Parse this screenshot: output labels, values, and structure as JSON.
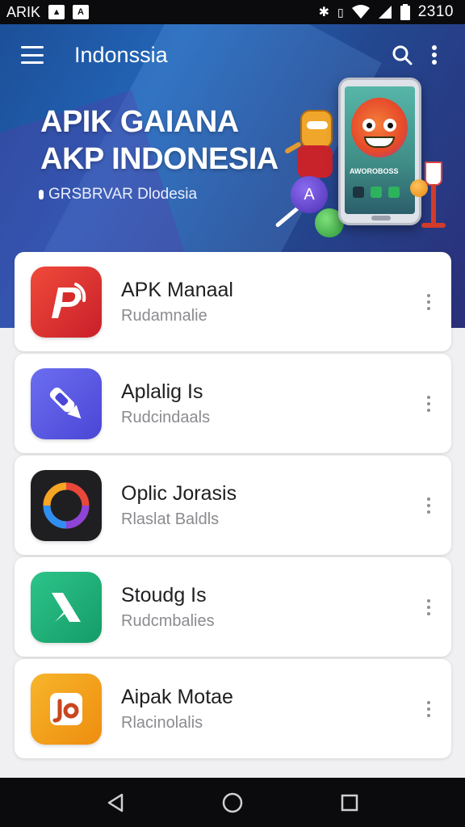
{
  "status_bar": {
    "carrier": "ARIK",
    "time": "2310",
    "icons": [
      "image-icon",
      "app-icon",
      "bluetooth-icon",
      "vibrate-icon",
      "wifi-icon",
      "signal-icon",
      "battery-icon"
    ]
  },
  "app_bar": {
    "title": "Indonssia",
    "icons": [
      "menu-icon",
      "search-icon",
      "more-vert-icon"
    ]
  },
  "hero": {
    "headline_line1": "APIK GAIANA",
    "headline_line2": "AKP INDONESIA",
    "subtitle": "GRSBRVAR Dlodesia",
    "phone_label": "AWOROBOSS"
  },
  "apps": [
    {
      "name": "APK Manaal",
      "subtitle": "Rudamnalie",
      "icon": "p-logo-icon",
      "color": "#e53030"
    },
    {
      "name": "Aplalig Is",
      "subtitle": "Rudcindaals",
      "icon": "pen-tool-icon",
      "color": "#5a5ce8"
    },
    {
      "name": "Oplic Jorasis",
      "subtitle": "Rlaslat Baldls",
      "icon": "ring-icon",
      "color": "#1f1f22"
    },
    {
      "name": "Stoudg Is",
      "subtitle": "Rudcmbalies",
      "icon": "x-arrow-icon",
      "color": "#1fb37a"
    },
    {
      "name": "Aipak Motae",
      "subtitle": "Rlacinolalis",
      "icon": "jo-icon",
      "color": "#f5a315"
    }
  ],
  "nav_bar": {
    "icons": [
      "back-icon",
      "home-icon",
      "recents-icon"
    ]
  }
}
